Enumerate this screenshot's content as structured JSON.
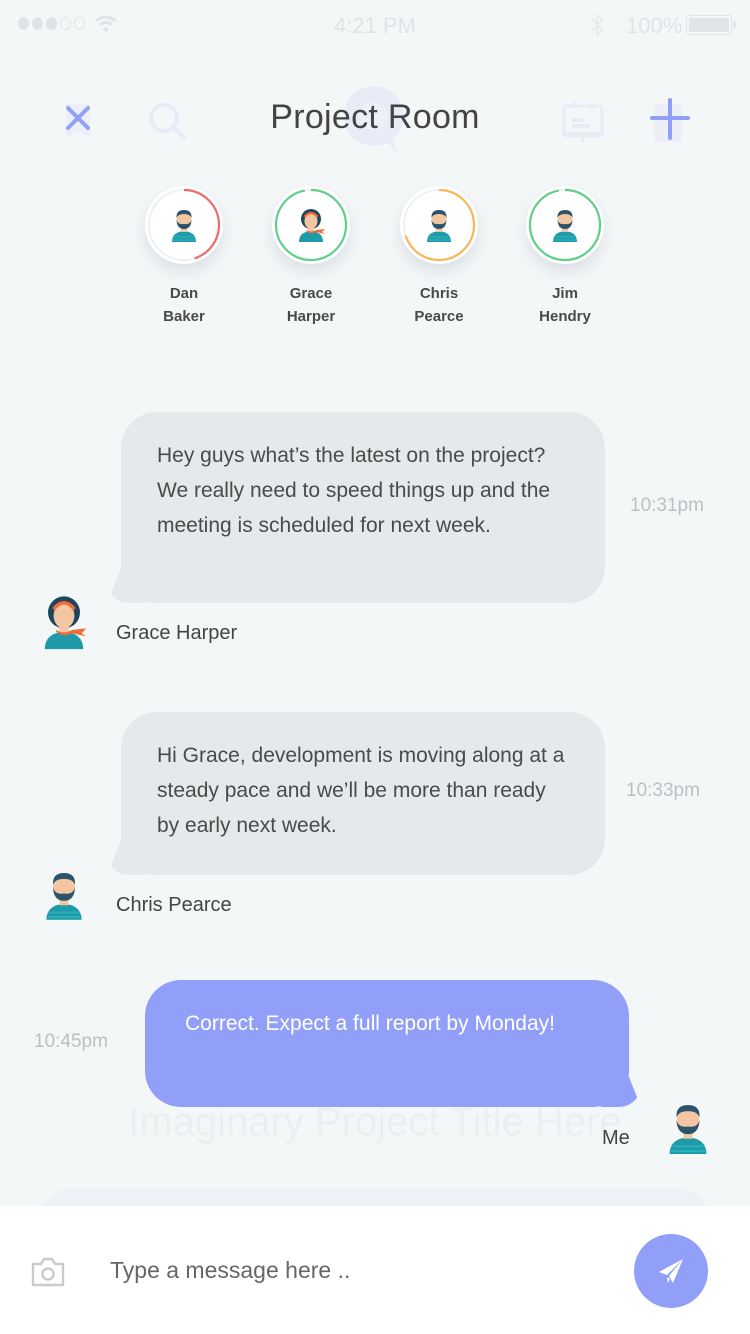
{
  "status_bar": {
    "signal_bars_filled": 3,
    "signal_bars_total": 5,
    "time": "4:21 PM",
    "battery_percent": "100%"
  },
  "header": {
    "title": "Project Room",
    "icons": [
      "close-icon",
      "search-icon",
      "board-icon",
      "add-icon"
    ]
  },
  "colors": {
    "accent": "#919ff8",
    "bubble_incoming": "#e5e9eb",
    "ring_red": "#f06b6b",
    "ring_green": "#5fcf8a",
    "ring_orange": "#f8b758"
  },
  "members": [
    {
      "first": "Dan",
      "last": "Baker",
      "ring_color": "#f06b6b",
      "progress": 0.45,
      "avatar": "man-beard"
    },
    {
      "first": "Grace",
      "last": "Harper",
      "ring_color": "#5fcf8a",
      "progress": 0.97,
      "avatar": "woman-scarf"
    },
    {
      "first": "Chris",
      "last": "Pearce",
      "ring_color": "#f8b758",
      "progress": 0.7,
      "avatar": "man-beard"
    },
    {
      "first": "Jim",
      "last": "Hendry",
      "ring_color": "#5fcf8a",
      "progress": 0.97,
      "avatar": "man-beard"
    }
  ],
  "messages": [
    {
      "sender": "Grace Harper",
      "text": "Hey guys what’s the latest on the project? We really need to speed things up and the meeting is scheduled for next week.",
      "time": "10:31pm",
      "direction": "incoming"
    },
    {
      "sender": "Chris Pearce",
      "text": "Hi Grace, development is moving along at a steady pace and we’ll be more than ready by early next week.",
      "time": "10:33pm",
      "direction": "incoming"
    },
    {
      "sender": "Me",
      "text": "Correct. Expect a full report by Monday!",
      "time": "10:45pm",
      "direction": "outgoing"
    }
  ],
  "background_watermark": "Imaginary Project Title Here",
  "composer": {
    "placeholder": "Type a message here ..",
    "value": ""
  }
}
